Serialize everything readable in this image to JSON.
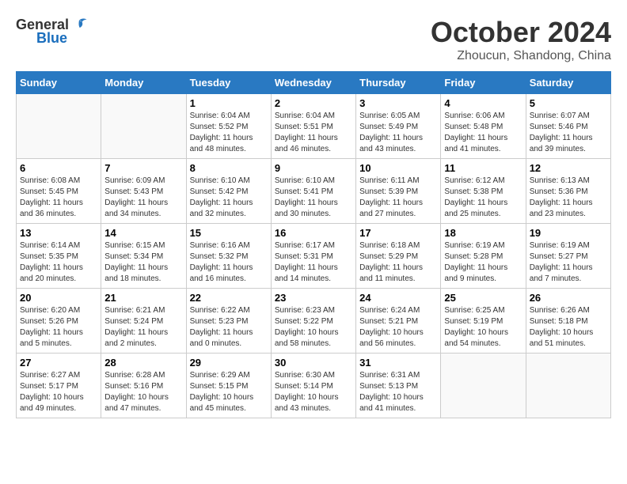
{
  "header": {
    "logo_general": "General",
    "logo_blue": "Blue",
    "month_title": "October 2024",
    "location": "Zhoucun, Shandong, China"
  },
  "weekdays": [
    "Sunday",
    "Monday",
    "Tuesday",
    "Wednesday",
    "Thursday",
    "Friday",
    "Saturday"
  ],
  "weeks": [
    [
      {
        "day": "",
        "info": ""
      },
      {
        "day": "",
        "info": ""
      },
      {
        "day": "1",
        "info": "Sunrise: 6:04 AM\nSunset: 5:52 PM\nDaylight: 11 hours and 48 minutes."
      },
      {
        "day": "2",
        "info": "Sunrise: 6:04 AM\nSunset: 5:51 PM\nDaylight: 11 hours and 46 minutes."
      },
      {
        "day": "3",
        "info": "Sunrise: 6:05 AM\nSunset: 5:49 PM\nDaylight: 11 hours and 43 minutes."
      },
      {
        "day": "4",
        "info": "Sunrise: 6:06 AM\nSunset: 5:48 PM\nDaylight: 11 hours and 41 minutes."
      },
      {
        "day": "5",
        "info": "Sunrise: 6:07 AM\nSunset: 5:46 PM\nDaylight: 11 hours and 39 minutes."
      }
    ],
    [
      {
        "day": "6",
        "info": "Sunrise: 6:08 AM\nSunset: 5:45 PM\nDaylight: 11 hours and 36 minutes."
      },
      {
        "day": "7",
        "info": "Sunrise: 6:09 AM\nSunset: 5:43 PM\nDaylight: 11 hours and 34 minutes."
      },
      {
        "day": "8",
        "info": "Sunrise: 6:10 AM\nSunset: 5:42 PM\nDaylight: 11 hours and 32 minutes."
      },
      {
        "day": "9",
        "info": "Sunrise: 6:10 AM\nSunset: 5:41 PM\nDaylight: 11 hours and 30 minutes."
      },
      {
        "day": "10",
        "info": "Sunrise: 6:11 AM\nSunset: 5:39 PM\nDaylight: 11 hours and 27 minutes."
      },
      {
        "day": "11",
        "info": "Sunrise: 6:12 AM\nSunset: 5:38 PM\nDaylight: 11 hours and 25 minutes."
      },
      {
        "day": "12",
        "info": "Sunrise: 6:13 AM\nSunset: 5:36 PM\nDaylight: 11 hours and 23 minutes."
      }
    ],
    [
      {
        "day": "13",
        "info": "Sunrise: 6:14 AM\nSunset: 5:35 PM\nDaylight: 11 hours and 20 minutes."
      },
      {
        "day": "14",
        "info": "Sunrise: 6:15 AM\nSunset: 5:34 PM\nDaylight: 11 hours and 18 minutes."
      },
      {
        "day": "15",
        "info": "Sunrise: 6:16 AM\nSunset: 5:32 PM\nDaylight: 11 hours and 16 minutes."
      },
      {
        "day": "16",
        "info": "Sunrise: 6:17 AM\nSunset: 5:31 PM\nDaylight: 11 hours and 14 minutes."
      },
      {
        "day": "17",
        "info": "Sunrise: 6:18 AM\nSunset: 5:29 PM\nDaylight: 11 hours and 11 minutes."
      },
      {
        "day": "18",
        "info": "Sunrise: 6:19 AM\nSunset: 5:28 PM\nDaylight: 11 hours and 9 minutes."
      },
      {
        "day": "19",
        "info": "Sunrise: 6:19 AM\nSunset: 5:27 PM\nDaylight: 11 hours and 7 minutes."
      }
    ],
    [
      {
        "day": "20",
        "info": "Sunrise: 6:20 AM\nSunset: 5:26 PM\nDaylight: 11 hours and 5 minutes."
      },
      {
        "day": "21",
        "info": "Sunrise: 6:21 AM\nSunset: 5:24 PM\nDaylight: 11 hours and 2 minutes."
      },
      {
        "day": "22",
        "info": "Sunrise: 6:22 AM\nSunset: 5:23 PM\nDaylight: 11 hours and 0 minutes."
      },
      {
        "day": "23",
        "info": "Sunrise: 6:23 AM\nSunset: 5:22 PM\nDaylight: 10 hours and 58 minutes."
      },
      {
        "day": "24",
        "info": "Sunrise: 6:24 AM\nSunset: 5:21 PM\nDaylight: 10 hours and 56 minutes."
      },
      {
        "day": "25",
        "info": "Sunrise: 6:25 AM\nSunset: 5:19 PM\nDaylight: 10 hours and 54 minutes."
      },
      {
        "day": "26",
        "info": "Sunrise: 6:26 AM\nSunset: 5:18 PM\nDaylight: 10 hours and 51 minutes."
      }
    ],
    [
      {
        "day": "27",
        "info": "Sunrise: 6:27 AM\nSunset: 5:17 PM\nDaylight: 10 hours and 49 minutes."
      },
      {
        "day": "28",
        "info": "Sunrise: 6:28 AM\nSunset: 5:16 PM\nDaylight: 10 hours and 47 minutes."
      },
      {
        "day": "29",
        "info": "Sunrise: 6:29 AM\nSunset: 5:15 PM\nDaylight: 10 hours and 45 minutes."
      },
      {
        "day": "30",
        "info": "Sunrise: 6:30 AM\nSunset: 5:14 PM\nDaylight: 10 hours and 43 minutes."
      },
      {
        "day": "31",
        "info": "Sunrise: 6:31 AM\nSunset: 5:13 PM\nDaylight: 10 hours and 41 minutes."
      },
      {
        "day": "",
        "info": ""
      },
      {
        "day": "",
        "info": ""
      }
    ]
  ]
}
